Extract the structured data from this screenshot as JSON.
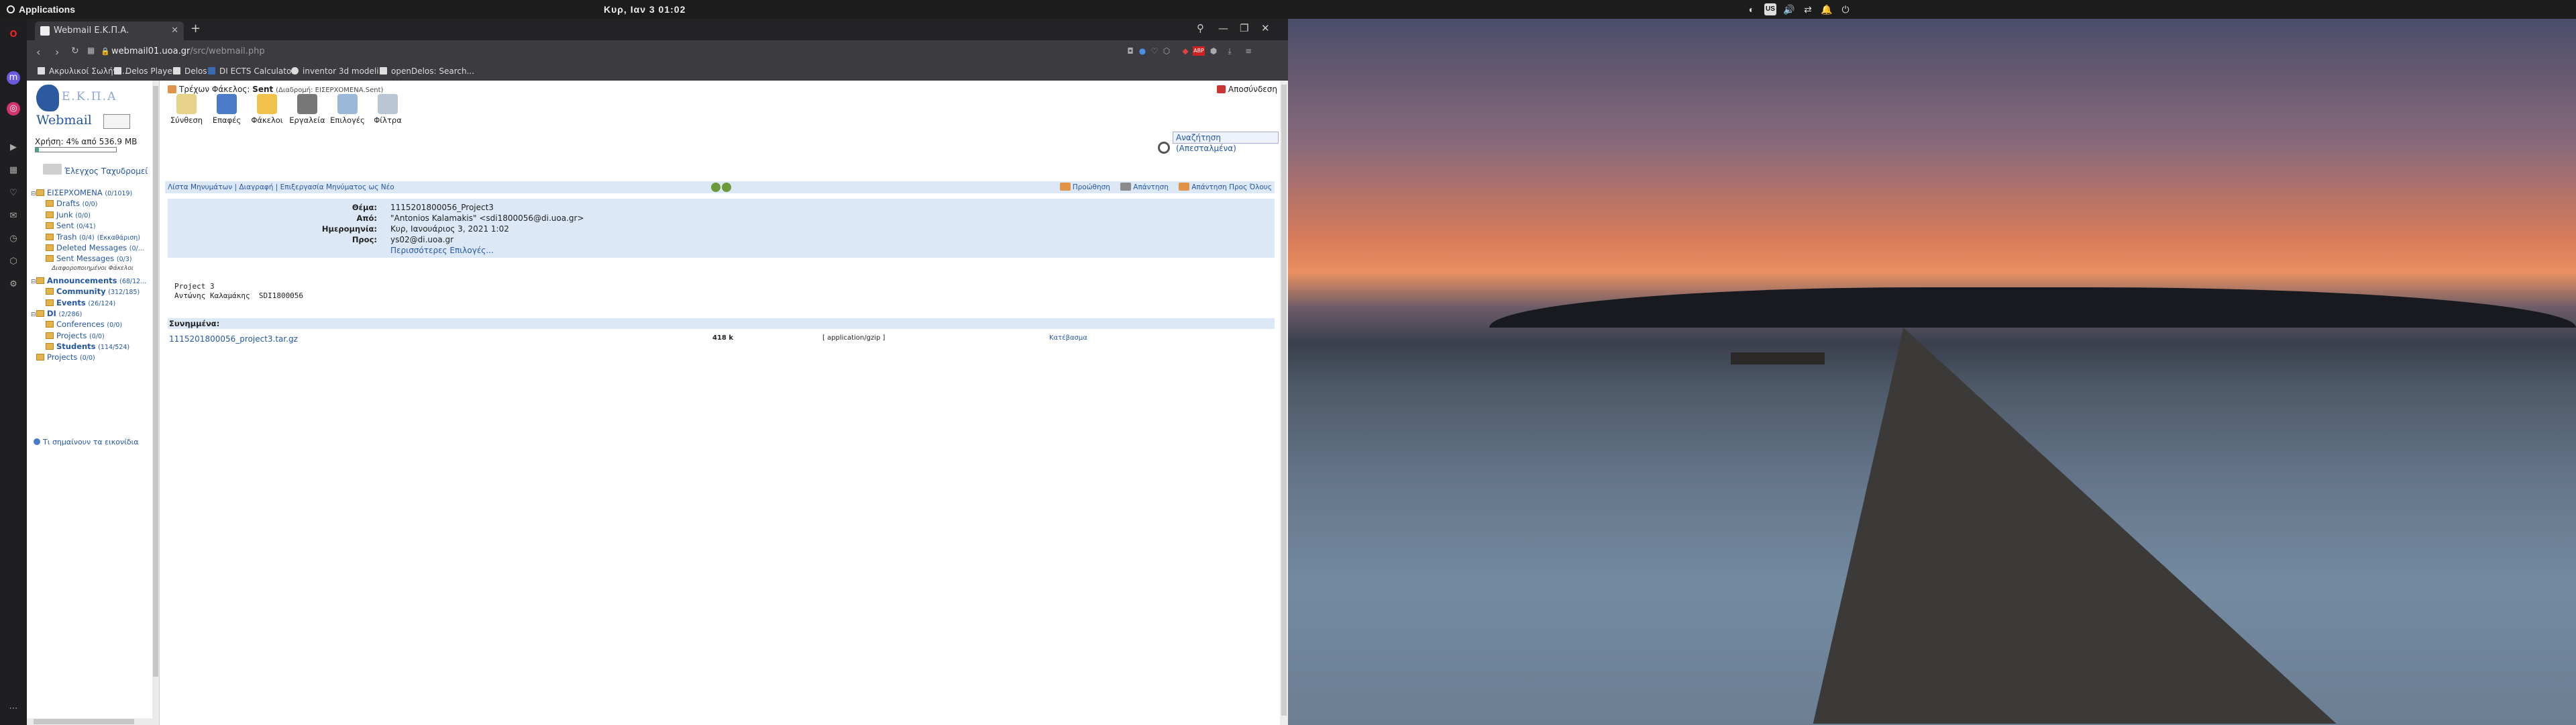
{
  "system": {
    "apps_label": "Applications",
    "clock": "Κυρ, Ιαν 3     01:02"
  },
  "browser": {
    "tab_title": "Webmail Ε.Κ.Π.Α.",
    "url_host": "webmail01.uoa.gr",
    "url_path": "/src/webmail.php",
    "bookmarks": [
      "Ακρυλικοί Σωλήνε...",
      "Delos Player",
      "Delos",
      "DI ECTS Calculator",
      "inventor 3d modeli...",
      "openDelos: Search..."
    ]
  },
  "sidebar": {
    "logo_ekpa": "Ε.Κ.Π.Α",
    "logo_title": "Webmail",
    "quota": "Χρήση: 4% από 536.9 MB",
    "quota_fraction": 0.04,
    "check_mail": "Έλεγχος Ταχυδρομεί",
    "folders": [
      {
        "label": "ΕΙΣΕΡΧΟΜΕΝΑ",
        "count": "(0/1019)",
        "toggle": "⊟",
        "indent": 0,
        "bold": false
      },
      {
        "label": "Drafts",
        "count": "(0/0)",
        "toggle": "",
        "indent": 1,
        "bold": false
      },
      {
        "label": "Junk",
        "count": "(0/0)",
        "toggle": "",
        "indent": 1,
        "bold": false
      },
      {
        "label": "Sent",
        "count": "(0/41)",
        "toggle": "",
        "indent": 1,
        "bold": false
      },
      {
        "label": "Trash",
        "count": "(0/4)",
        "toggle": "",
        "indent": 1,
        "bold": false,
        "extra": "(Εκκαθάριση)"
      },
      {
        "label": "Deleted Messages",
        "count": "(0/...",
        "toggle": "",
        "indent": 1,
        "bold": false
      },
      {
        "label": "Sent Messages",
        "count": "(0/3)",
        "toggle": "",
        "indent": 1,
        "bold": false
      }
    ],
    "subscribed_label": "Διαφοροποιημένοι Φάκελοι",
    "folders2": [
      {
        "label": "Announcements",
        "count": "(68/12...",
        "toggle": "⊟",
        "indent": 0,
        "bold": true
      },
      {
        "label": "Community",
        "count": "(312/185)",
        "toggle": "",
        "indent": 1,
        "bold": true
      },
      {
        "label": "Events",
        "count": "(26/124)",
        "toggle": "",
        "indent": 1,
        "bold": true
      },
      {
        "label": "DI",
        "count": "(2/286)",
        "toggle": "⊟",
        "indent": 0,
        "bold": true
      },
      {
        "label": "Conferences",
        "count": "(0/0)",
        "toggle": "",
        "indent": 1,
        "bold": false
      },
      {
        "label": "Projects",
        "count": "(0/0)",
        "toggle": "",
        "indent": 1,
        "bold": false
      },
      {
        "label": "Students",
        "count": "(114/524)",
        "toggle": "",
        "indent": 1,
        "bold": true
      },
      {
        "label": "Projects",
        "count": "(0/0)",
        "toggle": "",
        "indent": 0,
        "bold": false
      }
    ],
    "help": "Τι σημαίνουν τα εικονίδια"
  },
  "main": {
    "current_folder_label": "Τρέχων Φάκελος:",
    "current_folder": "Sent",
    "current_folder_path": "(Διαδρομή: ΕΙΣΕΡΧΟΜΕΝΑ.Sent)",
    "logout": "Αποσύνδεση",
    "toolbar": [
      "Σύνθεση",
      "Επαφές",
      "Φάκελοι",
      "Εργαλεία",
      "Επιλογές",
      "Φίλτρα"
    ],
    "search": "Αναζήτηση (Απεσταλμένα)",
    "nav_links": "Λίστα Μηνυμάτων | Διαγραφή | Επιξεργασία Μηνύματος ως Νέο",
    "actions": [
      "Προώθηση",
      "Απάντηση",
      "Απάντηση Προς Όλους"
    ],
    "headers": [
      {
        "k": "Θέμα:",
        "v": "1115201800056_Project3"
      },
      {
        "k": "Από:",
        "v": "\"Antonios Kalamakis\" <sdi1800056@di.uoa.gr>"
      },
      {
        "k": "Ημερομηνία:",
        "v": "Κυρ, Ιανουάριος 3, 2021 1:02"
      },
      {
        "k": "Προς:",
        "v": "ys02@di.uoa.gr"
      }
    ],
    "more_options": "Περισσότερες Επιλογές...",
    "body": "Project 3\nΑντώνης Καλαμάκης  SDI1800056",
    "attachments_label": "Συνημμένα:",
    "attachment": {
      "name": "1115201800056_project3.tar.gz",
      "size": "418 k",
      "type": "[ application/gzip ]",
      "download": "Κατέβασμα"
    }
  }
}
